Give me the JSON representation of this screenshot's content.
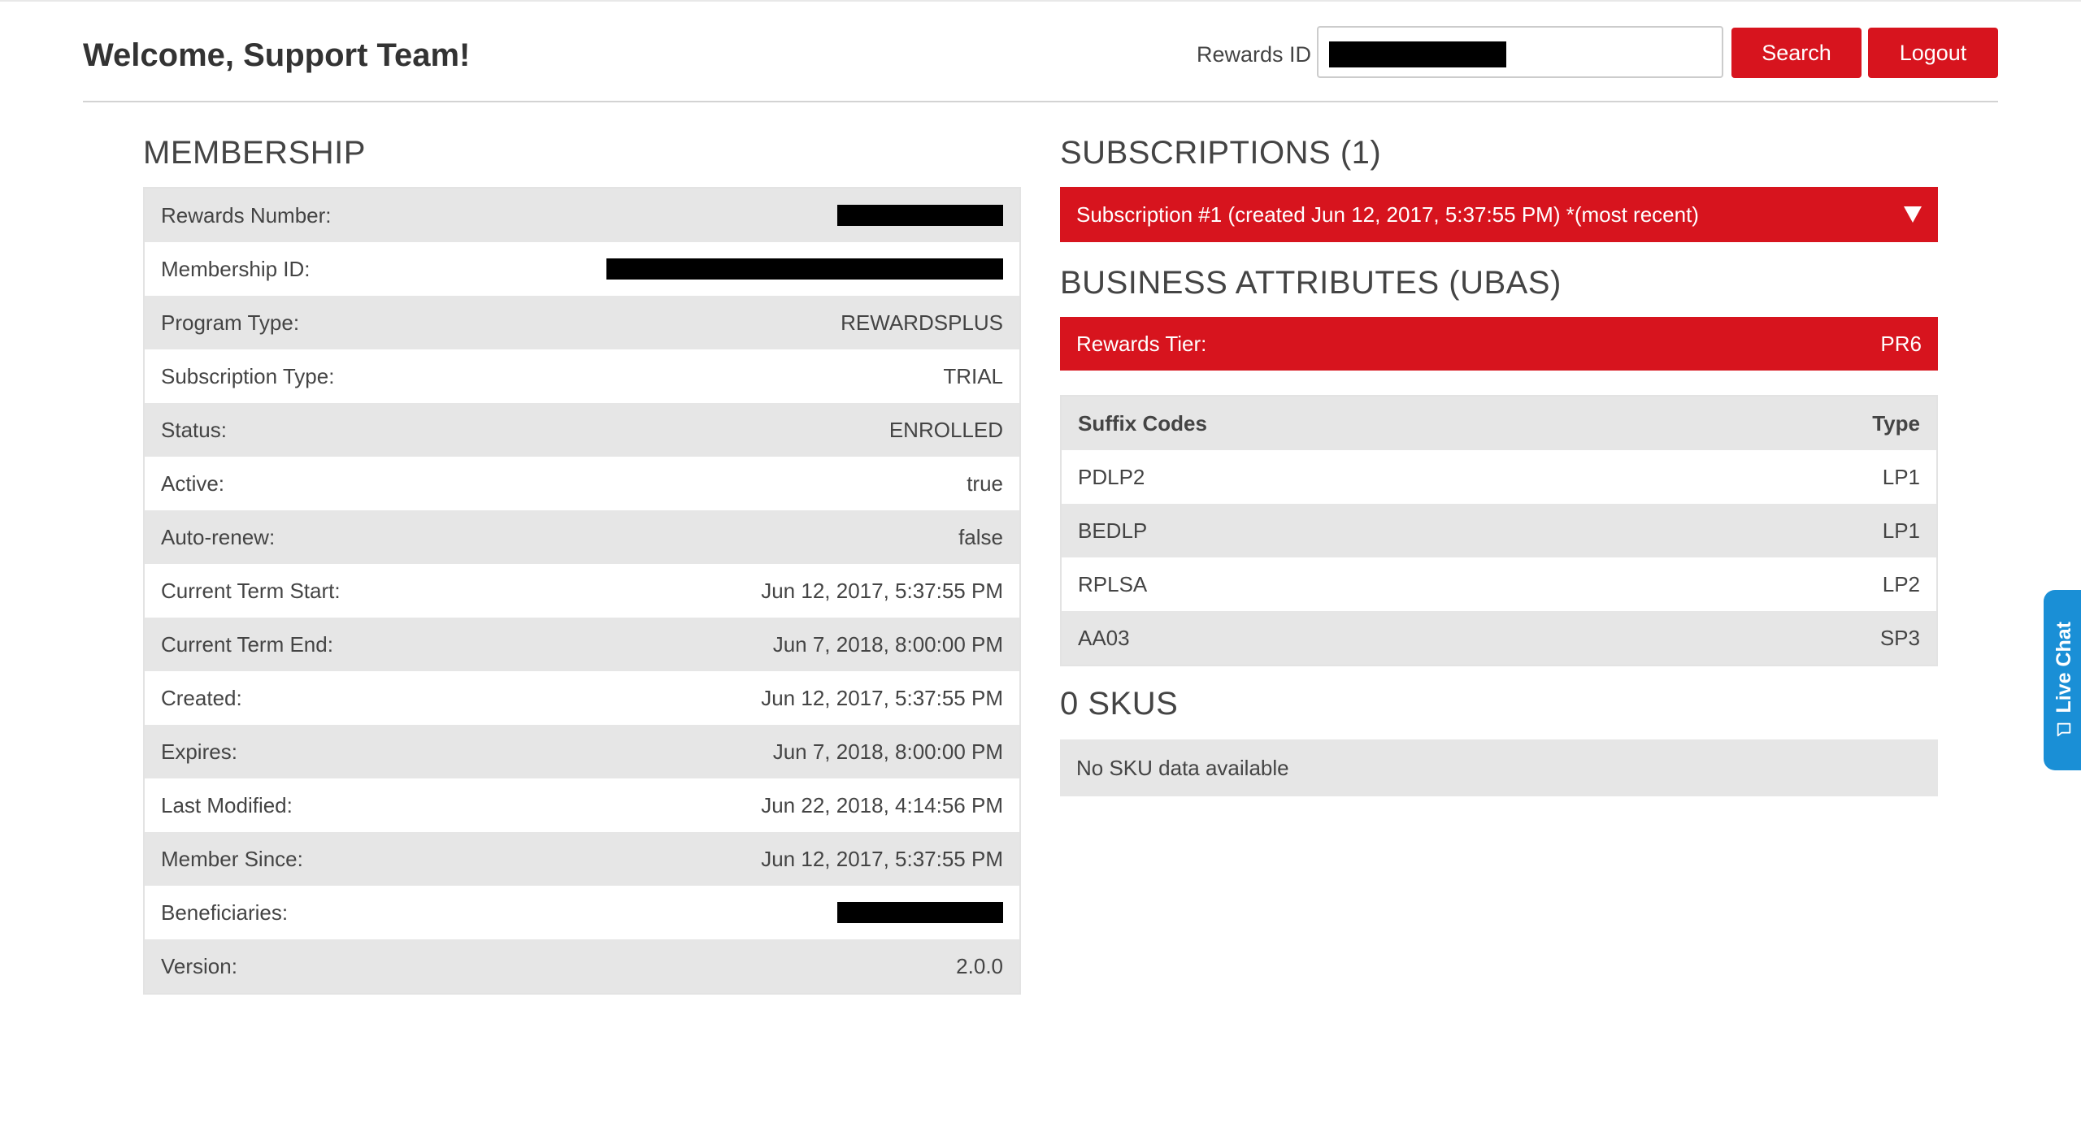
{
  "header": {
    "welcome": "Welcome, Support Team!",
    "rewards_id_label": "Rewards ID",
    "rewards_id_value": "",
    "search_label": "Search",
    "logout_label": "Logout"
  },
  "membership": {
    "title": "MEMBERSHIP",
    "rows": [
      {
        "label": "Rewards Number:",
        "value": "",
        "redacted": true
      },
      {
        "label": "Membership ID:",
        "value": "",
        "redacted": true
      },
      {
        "label": "Program Type:",
        "value": "REWARDSPLUS"
      },
      {
        "label": "Subscription Type:",
        "value": "TRIAL"
      },
      {
        "label": "Status:",
        "value": "ENROLLED"
      },
      {
        "label": "Active:",
        "value": "true"
      },
      {
        "label": "Auto-renew:",
        "value": "false"
      },
      {
        "label": "Current Term Start:",
        "value": "Jun 12, 2017, 5:37:55 PM"
      },
      {
        "label": "Current Term End:",
        "value": "Jun 7, 2018, 8:00:00 PM"
      },
      {
        "label": "Created:",
        "value": "Jun 12, 2017, 5:37:55 PM"
      },
      {
        "label": "Expires:",
        "value": "Jun 7, 2018, 8:00:00 PM"
      },
      {
        "label": "Last Modified:",
        "value": "Jun 22, 2018, 4:14:56 PM"
      },
      {
        "label": "Member Since:",
        "value": "Jun 12, 2017, 5:37:55 PM"
      },
      {
        "label": "Beneficiaries:",
        "value": "",
        "redacted": true
      },
      {
        "label": "Version:",
        "value": "2.0.0"
      }
    ]
  },
  "subscriptions": {
    "title": "SUBSCRIPTIONS (1)",
    "item_label": "Subscription #1 (created Jun 12, 2017, 5:37:55 PM) *(most recent)",
    "expand_icon": "triangle-down-icon"
  },
  "business_attributes": {
    "title": "BUSINESS ATTRIBUTES (UBAS)",
    "tier_label": "Rewards Tier:",
    "tier_value": "PR6",
    "columns": [
      "Suffix Codes",
      "Type"
    ],
    "rows": [
      [
        "PDLP2",
        "LP1"
      ],
      [
        "BEDLP",
        "LP1"
      ],
      [
        "RPLSA",
        "LP2"
      ],
      [
        "AA03",
        "SP3"
      ]
    ]
  },
  "skus": {
    "title": "0 SKUS",
    "empty_text": "No SKU data available"
  },
  "live_chat": {
    "label": "Live Chat",
    "icon": "chat-bubble-icon"
  },
  "colors": {
    "accent": "#d7141e",
    "chat": "#1a8fd6",
    "row_alt": "#e6e6e6"
  }
}
